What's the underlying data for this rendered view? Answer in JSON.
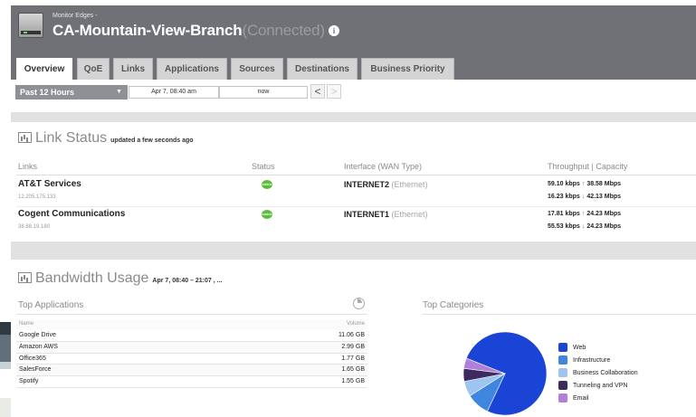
{
  "header": {
    "breadcrumb": "Monitor Edges -",
    "device_name": "CA-Mountain-View-Branch",
    "device_status": "(Connected)",
    "info_icon": "info-icon"
  },
  "tabs": [
    {
      "label": "Overview",
      "active": true
    },
    {
      "label": "QoE"
    },
    {
      "label": "Links"
    },
    {
      "label": "Applications"
    },
    {
      "label": "Sources"
    },
    {
      "label": "Destinations"
    },
    {
      "label": "Business Priority"
    }
  ],
  "filter": {
    "range": "Past 12 Hours",
    "start": "Apr 7, 08:40 am",
    "separator": "-",
    "end": "now",
    "prev": "<",
    "next": ">"
  },
  "link_status": {
    "title": "Link Status",
    "subtitle": "updated a few seconds ago",
    "columns": {
      "links": "Links",
      "status": "Status",
      "interface": "Interface (WAN Type)",
      "throughput": "Throughput | Capacity"
    },
    "rows": [
      {
        "name": "AT&T Services",
        "ip": "12.205.175.133",
        "status": "stable",
        "interface": "INTERNET2",
        "wan_type": "(Ethernet)",
        "up": "59.10 kbps",
        "up_capacity": "38.58 Mbps",
        "down": "16.23 kbps",
        "down_capacity": "42.13 Mbps"
      },
      {
        "name": "Cogent Communications",
        "ip": "38.88.19.180",
        "status": "stable",
        "interface": "INTERNET1",
        "wan_type": "(Ethernet)",
        "up": "17.81 kbps",
        "up_capacity": "24.23 Mbps",
        "down": "55.53 kbps",
        "down_capacity": "24.23 Mbps"
      }
    ]
  },
  "bandwidth": {
    "title": "Bandwidth Usage",
    "subtitle": "Apr 7, 08:40 – 21:07 , ...",
    "top_apps": {
      "label": "Top Applications",
      "col_name": "Name",
      "col_volume": "Volume",
      "rows": [
        {
          "name": "Google Drive",
          "volume": "11.06 GB"
        },
        {
          "name": "Amazon AWS",
          "volume": "2.99 GB"
        },
        {
          "name": "Office365",
          "volume": "1.77 GB"
        },
        {
          "name": "SalesForce",
          "volume": "1.65 GB"
        },
        {
          "name": "Spotify",
          "volume": "1.55 GB"
        }
      ]
    },
    "top_categories": {
      "label": "Top Categories",
      "slices": [
        {
          "name": "Web",
          "value": 76,
          "color": "#1a44d6"
        },
        {
          "name": "Infrastructure",
          "value": 9,
          "color": "#3f86e0"
        },
        {
          "name": "Business Collaboration",
          "value": 6,
          "color": "#9ec4f0"
        },
        {
          "name": "Tunneling and VPN",
          "value": 5,
          "color": "#3d2a5e"
        },
        {
          "name": "Email",
          "value": 4,
          "color": "#b07fd9"
        }
      ]
    }
  }
}
